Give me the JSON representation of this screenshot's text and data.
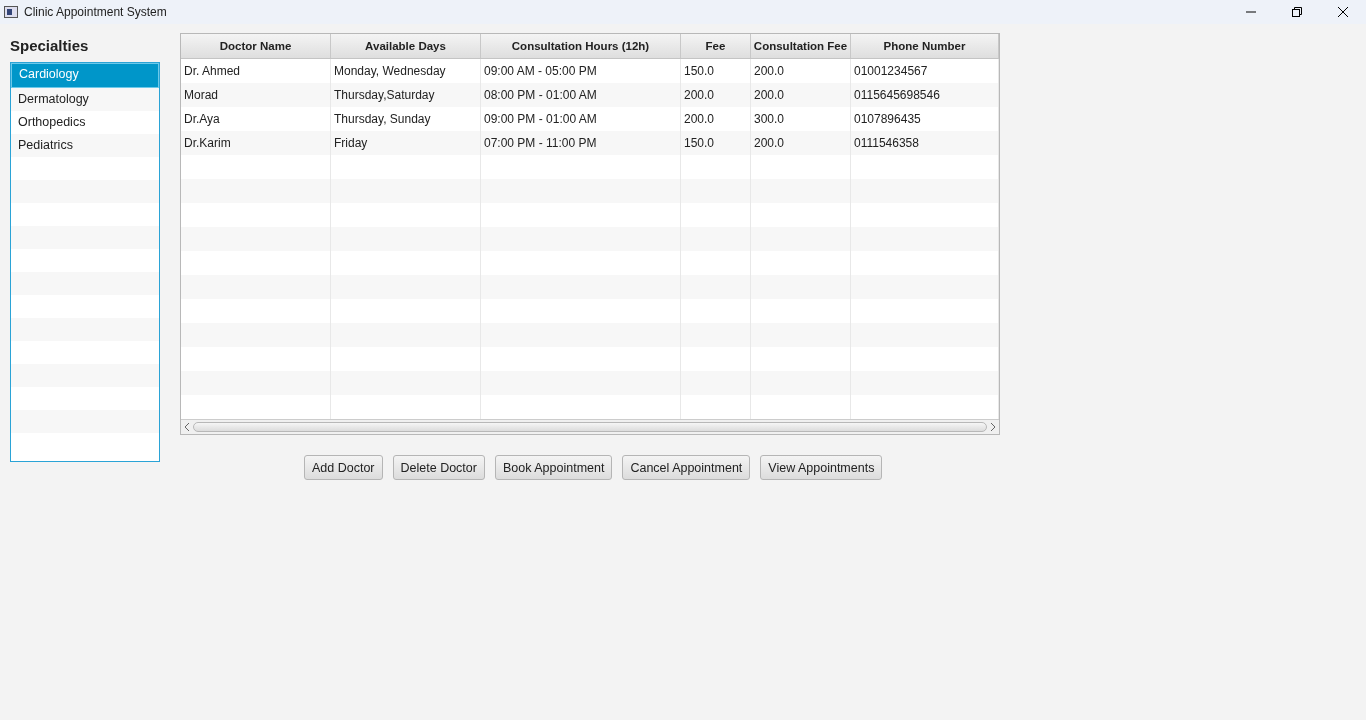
{
  "window": {
    "title": "Clinic Appointment System"
  },
  "sidebar": {
    "heading": "Specialties",
    "items": [
      {
        "label": "Cardiology",
        "selected": true
      },
      {
        "label": "Dermatology",
        "selected": false
      },
      {
        "label": "Orthopedics",
        "selected": false
      },
      {
        "label": "Pediatrics",
        "selected": false
      }
    ]
  },
  "table": {
    "columns": [
      "Doctor Name",
      "Available Days",
      "Consultation Hours (12h)",
      "Fee",
      "Consultation Fee",
      "Phone Number"
    ],
    "rows": [
      {
        "cells": [
          "Dr. Ahmed",
          "Monday, Wednesday",
          "09:00 AM - 05:00 PM",
          "150.0",
          "200.0",
          "01001234567"
        ],
        "selected": false
      },
      {
        "cells": [
          "Morad",
          "Thursday,Saturday",
          "08:00 PM - 01:00 AM",
          "200.0",
          "200.0",
          "0115645698546"
        ],
        "selected": false
      },
      {
        "cells": [
          "Dr.Aya",
          "Thursday, Sunday",
          "09:00 PM - 01:00 AM",
          "200.0",
          "300.0",
          "0107896435"
        ],
        "selected": false
      },
      {
        "cells": [
          "Dr.Karim",
          "Friday",
          "07:00 PM - 11:00 PM",
          "150.0",
          "200.0",
          "0111546358"
        ],
        "selected": false
      }
    ]
  },
  "buttons": [
    "Add Doctor",
    "Delete Doctor",
    "Book Appointment",
    "Cancel Appointment",
    "View Appointments"
  ]
}
